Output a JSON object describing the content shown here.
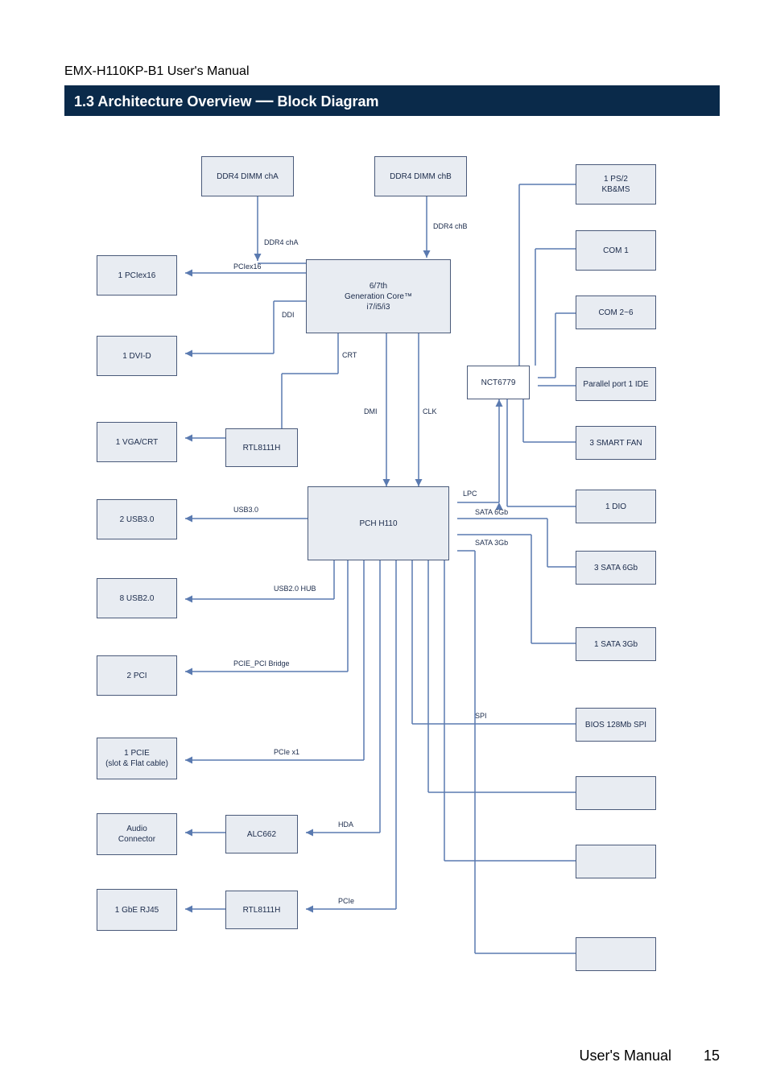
{
  "header_small": "EMX-H110KP-B1 User's Manual",
  "section_title_pre": "1.3 Architecture Overview",
  "section_dash": "—",
  "section_title_post": "Block Diagram",
  "chart_data": {
    "type": "block-diagram",
    "nodes": {
      "cpu": "6/7th\nGeneration Core™\ni7/i5/i3",
      "pch": "PCH\nH110",
      "sio": "NCT6779",
      "audio": "ALC662",
      "lan": "RTL8111H",
      "ddr4_a": "DDR4 DIMM chA",
      "ddr4_b": "DDR4 DIMM chB",
      "pciex16": "1 PCIex16",
      "dvi": "1 DVI-D",
      "vga_crt": "1 VGA/CRT",
      "ps2": "1 PS/2\nKB&MS",
      "com1": "COM 1",
      "com26": "COM 2~6",
      "parallel": "Parallel port 1 IDE",
      "fan3": "3 SMART FAN",
      "dio1": "1 DIO",
      "sata3": "3 SATA 6Gb",
      "sata1": "1 SATA 3Gb",
      "usb3": "2 USB3.0",
      "usb2": "8 USB2.0",
      "pci": "2 PCI",
      "pcie_slot": "1 PCIE\n(slot & Flat cable)",
      "audio_conn": "Audio\nConnector",
      "rj45": "1 GbE RJ45",
      "spi": "BIOS\n128Mb SPI"
    },
    "edges": [
      [
        "cpu",
        "ddr4_a",
        "DDR4 chA"
      ],
      [
        "cpu",
        "ddr4_b",
        "DDR4 chB"
      ],
      [
        "cpu",
        "pciex16",
        "PCIex16"
      ],
      [
        "cpu",
        "dvi",
        "DDI"
      ],
      [
        "cpu",
        "vga_crt",
        "CRT"
      ],
      [
        "cpu",
        "pch",
        "DMI"
      ],
      [
        "cpu",
        "pch",
        "CLK"
      ],
      [
        "pch",
        "sio",
        "LPC"
      ],
      [
        "sio",
        "ps2",
        ""
      ],
      [
        "sio",
        "com1",
        ""
      ],
      [
        "sio",
        "com26",
        ""
      ],
      [
        "sio",
        "parallel",
        ""
      ],
      [
        "sio",
        "fan3",
        ""
      ],
      [
        "sio",
        "dio1",
        ""
      ],
      [
        "pch",
        "sata3",
        "SATA 6Gb"
      ],
      [
        "pch",
        "sata1",
        "SATA 3Gb"
      ],
      [
        "pch",
        "usb3",
        "USB3.0"
      ],
      [
        "pch",
        "usb2",
        "USB2.0 HUB"
      ],
      [
        "pch",
        "pci",
        "PCIE_PCI Bridge"
      ],
      [
        "pch",
        "pcie_slot",
        "PCIe x1"
      ],
      [
        "pch",
        "audio",
        "HDA"
      ],
      [
        "audio",
        "audio_conn",
        ""
      ],
      [
        "pch",
        "lan",
        "PCIe"
      ],
      [
        "lan",
        "rj45",
        ""
      ],
      [
        "pch",
        "spi",
        "SPI"
      ]
    ]
  },
  "edge_labels": {
    "cha": "DDR4 chA",
    "chb": "DDR4 chB",
    "pciex16": "PCIex16",
    "ddi": "DDI",
    "crt": "CRT",
    "dmi": "DMI",
    "clk": "CLK",
    "lpc": "LPC",
    "sata6": "SATA 6Gb",
    "sata3g": "SATA 3Gb",
    "usb3": "USB3.0",
    "usb2hub": "USB2.0 HUB",
    "pciebridge": "PCIE_PCI Bridge",
    "pciex1": "PCIe x1",
    "hda": "HDA",
    "pcie": "PCIe",
    "spi": "SPI"
  },
  "footer": "User's Manual",
  "page_number": "15"
}
